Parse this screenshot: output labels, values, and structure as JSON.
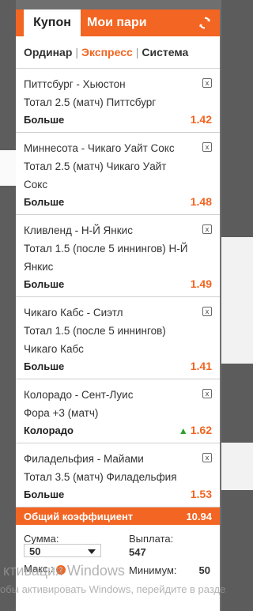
{
  "tabs": {
    "coupon": "Купон",
    "my_bets": "Мои пари"
  },
  "refresh_icon": "refresh-icon",
  "modes": [
    "Ординар",
    "Экспресс",
    "Система"
  ],
  "active_mode": "Экспресс",
  "bets": [
    {
      "event": "Питтсбург - Хьюстон",
      "market": "Тотал 2.5 (матч) Питтсбург",
      "pick": "Больше",
      "odd": "1.42",
      "arrow_up": false
    },
    {
      "event": "Миннесота - Чикаго Уайт Сокс",
      "market": "Тотал 2.5 (матч) Чикаго Уайт Сокс",
      "pick": "Больше",
      "odd": "1.48",
      "arrow_up": false
    },
    {
      "event": "Кливленд - Н-Й Янкис",
      "market": "Тотал 1.5 (после 5 иннингов) Н-Й Янкис",
      "pick": "Больше",
      "odd": "1.49",
      "arrow_up": false
    },
    {
      "event": "Чикаго Кабс - Сиэтл",
      "market": "Тотал 1.5 (после 5 иннингов) Чикаго Кабс",
      "pick": "Больше",
      "odd": "1.41",
      "arrow_up": false
    },
    {
      "event": "Колорадо - Сент-Луис",
      "market": "Фора +3 (матч)",
      "pick": "Колорадо",
      "odd": "1.62",
      "arrow_up": true
    },
    {
      "event": "Филадельфия - Майами",
      "market": "Тотал 3.5 (матч) Филадельфия",
      "pick": "Больше",
      "odd": "1.53",
      "arrow_up": false
    }
  ],
  "total": {
    "label": "Общий коэффициент",
    "value": "10.94"
  },
  "stake": {
    "sum_label": "Сумма:",
    "sum_value": "50",
    "payout_label": "Выплата:",
    "payout_value": "547",
    "max_label": "Макс.:",
    "min_label": "Минимум:",
    "min_value": "50"
  },
  "watermark": {
    "line1": "ктивация Windows",
    "line2": "обы активировать Windows, перейдите в разде"
  },
  "colors": {
    "accent": "#f26522",
    "arrow_up": "#2ca02c"
  }
}
